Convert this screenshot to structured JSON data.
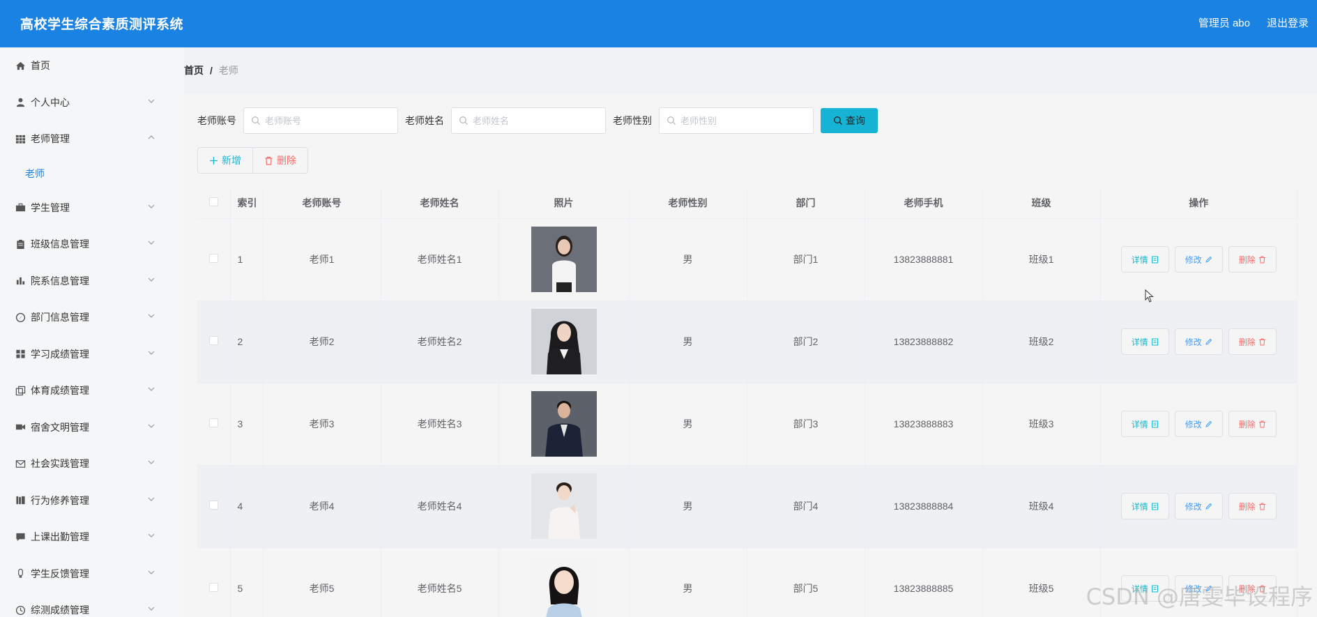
{
  "header": {
    "title": "高校学生综合素质测评系统",
    "user": "管理员 abo",
    "logout": "退出登录"
  },
  "sidebar": {
    "items": [
      {
        "label": "首页",
        "icon": "home-icon",
        "arrow": "none"
      },
      {
        "label": "个人中心",
        "icon": "user-icon",
        "arrow": "down"
      },
      {
        "label": "老师管理",
        "icon": "grid-icon",
        "arrow": "up"
      },
      {
        "label": "学生管理",
        "icon": "briefcase-icon",
        "arrow": "down"
      },
      {
        "label": "班级信息管理",
        "icon": "clipboard-icon",
        "arrow": "down"
      },
      {
        "label": "院系信息管理",
        "icon": "bar-chart-icon",
        "arrow": "down"
      },
      {
        "label": "部门信息管理",
        "icon": "compass-icon",
        "arrow": "down"
      },
      {
        "label": "学习成绩管理",
        "icon": "dashboard-icon",
        "arrow": "down"
      },
      {
        "label": "体育成绩管理",
        "icon": "copy-icon",
        "arrow": "down"
      },
      {
        "label": "宿舍文明管理",
        "icon": "video-icon",
        "arrow": "down"
      },
      {
        "label": "社会实践管理",
        "icon": "mail-icon",
        "arrow": "down"
      },
      {
        "label": "行为修养管理",
        "icon": "library-icon",
        "arrow": "down"
      },
      {
        "label": "上课出勤管理",
        "icon": "chat-icon",
        "arrow": "down"
      },
      {
        "label": "学生反馈管理",
        "icon": "bulb-icon",
        "arrow": "down"
      },
      {
        "label": "综测成绩管理",
        "icon": "clock-icon",
        "arrow": "down"
      }
    ],
    "subitem": "老师"
  },
  "breadcrumb": {
    "home": "首页",
    "sep": "/",
    "current": "老师"
  },
  "search": {
    "account_label": "老师账号",
    "account_placeholder": "老师账号",
    "name_label": "老师姓名",
    "name_placeholder": "老师姓名",
    "gender_label": "老师性别",
    "gender_placeholder": "老师性别",
    "query_label": "查询"
  },
  "actions": {
    "add_label": "新增",
    "delete_label": "删除"
  },
  "table": {
    "headers": [
      "索引",
      "老师账号",
      "老师姓名",
      "照片",
      "老师性别",
      "部门",
      "老师手机",
      "班级",
      "操作"
    ],
    "rows": [
      {
        "index": "1",
        "account": "老师1",
        "name": "老师姓名1",
        "gender": "男",
        "dept": "部门1",
        "phone": "13823888881",
        "class": "班级1"
      },
      {
        "index": "2",
        "account": "老师2",
        "name": "老师姓名2",
        "gender": "男",
        "dept": "部门2",
        "phone": "13823888882",
        "class": "班级2"
      },
      {
        "index": "3",
        "account": "老师3",
        "name": "老师姓名3",
        "gender": "男",
        "dept": "部门3",
        "phone": "13823888883",
        "class": "班级3"
      },
      {
        "index": "4",
        "account": "老师4",
        "name": "老师姓名4",
        "gender": "男",
        "dept": "部门4",
        "phone": "13823888884",
        "class": "班级4"
      },
      {
        "index": "5",
        "account": "老师5",
        "name": "老师姓名5",
        "gender": "男",
        "dept": "部门5",
        "phone": "13823888885",
        "class": "班级5"
      }
    ],
    "op_detail": "详情",
    "op_edit": "修改",
    "op_delete": "删除"
  },
  "watermark": "CSDN @唐雯毕设程序",
  "colors": {
    "header_bg": "#1a82e2",
    "accent": "#1ab6d0",
    "danger": "#f56c6c",
    "query_btn": "#17b3d4"
  }
}
